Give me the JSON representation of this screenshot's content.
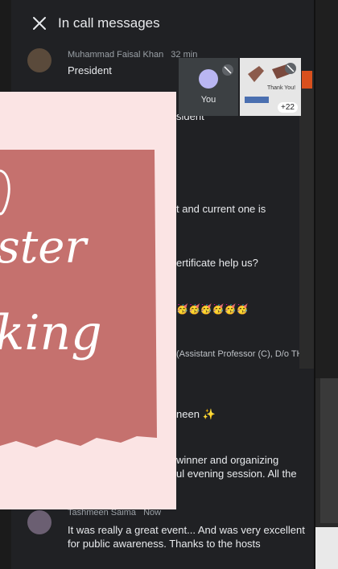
{
  "header": {
    "title": "In call messages"
  },
  "messages": [
    {
      "author": "Muhammad Faisal Khan",
      "time": "32 min",
      "text": "President"
    },
    {
      "author": "",
      "time": "",
      "text": "sident"
    },
    {
      "author": "",
      "time": "",
      "text": "t and current one is"
    },
    {
      "author": "",
      "time": "",
      "text": "ertificate help us?"
    },
    {
      "author": "",
      "time": "",
      "text": "🥳🥳🥳🥳🥳🥳"
    },
    {
      "author": "",
      "time": "",
      "text": "(Assistant Professor (C), D/o TH"
    },
    {
      "author": "",
      "time": "",
      "text": "neen ✨"
    },
    {
      "author": "",
      "time": "",
      "text": "winner and organizing"
    },
    {
      "author": "",
      "time": "",
      "text": "ul evening session. All the"
    },
    {
      "author": "Tashmeen Saima",
      "time": "Now",
      "text": "It was really a great event... And was very excellent for public awareness. Thanks to the hosts"
    }
  ],
  "self_tile": {
    "label": "You"
  },
  "share_tile": {
    "thanks": "Thank You!",
    "count": "+22"
  },
  "poster": {
    "line1": "ster",
    "line2": "king"
  }
}
